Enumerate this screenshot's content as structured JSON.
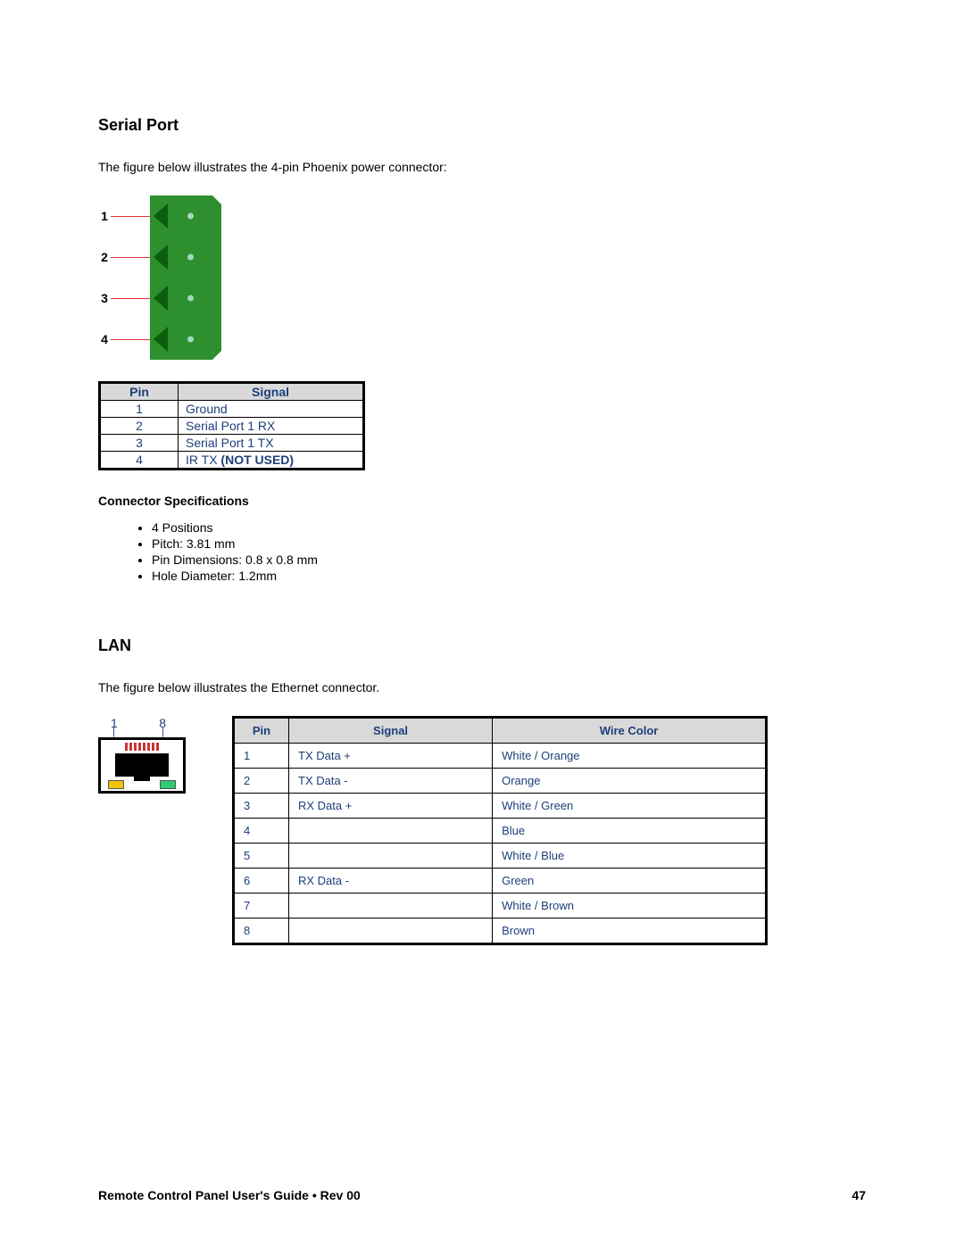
{
  "sections": {
    "serial": {
      "heading": "Serial Port",
      "intro": "The figure below illustrates the 4-pin Phoenix power connector:",
      "pins": [
        "1",
        "2",
        "3",
        "4"
      ],
      "table_headers": {
        "pin": "Pin",
        "signal": "Signal"
      },
      "table_rows": [
        {
          "pin": "1",
          "signal": "Ground"
        },
        {
          "pin": "2",
          "signal": "Serial Port 1 RX"
        },
        {
          "pin": "3",
          "signal": "Serial Port 1 TX"
        },
        {
          "pin": "4",
          "signal_prefix": "IR TX ",
          "signal_bold": "(NOT USED)"
        }
      ],
      "spec_heading": "Connector Specifications",
      "specs": [
        "4 Positions",
        "Pitch: 3.81 mm",
        "Pin Dimensions: 0.8 x 0.8 mm",
        "Hole Diameter: 1.2mm"
      ]
    },
    "lan": {
      "heading": "LAN",
      "intro": "The figure below illustrates the Ethernet connector.",
      "jack_labels": {
        "left": "1",
        "right": "8"
      },
      "table_headers": {
        "pin": "Pin",
        "signal": "Signal",
        "wire": "Wire Color"
      },
      "table_rows": [
        {
          "pin": "1",
          "signal": "TX Data +",
          "wire": "White / Orange"
        },
        {
          "pin": "2",
          "signal": "TX Data -",
          "wire": "Orange"
        },
        {
          "pin": "3",
          "signal": "RX Data +",
          "wire": "White / Green"
        },
        {
          "pin": "4",
          "signal": "",
          "wire": "Blue"
        },
        {
          "pin": "5",
          "signal": "",
          "wire": "White / Blue"
        },
        {
          "pin": "6",
          "signal": "RX Data -",
          "wire": "Green"
        },
        {
          "pin": "7",
          "signal": "",
          "wire": "White / Brown"
        },
        {
          "pin": "8",
          "signal": "",
          "wire": "Brown"
        }
      ]
    }
  },
  "footer": {
    "title_prefix": "Remote Control Panel User's Guide ",
    "bullet": "•",
    "title_suffix": " Rev 00",
    "page": "47"
  }
}
